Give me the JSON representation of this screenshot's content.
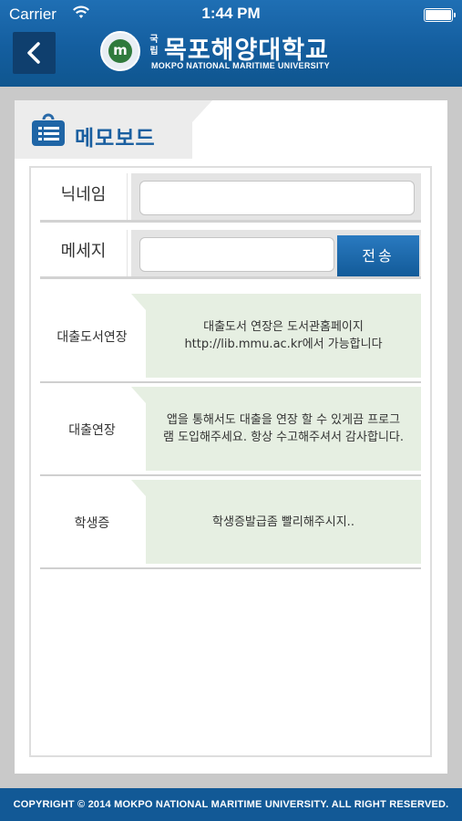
{
  "status_bar": {
    "carrier": "Carrier",
    "time": "1:44 PM"
  },
  "header": {
    "back_icon": "chevron-left-icon",
    "logo_badge": "국립",
    "logo_title": "목포해양대학교",
    "logo_subtitle": "MOKPO NATIONAL MARITIME UNIVERSITY",
    "emblem_letter": "m",
    "background_color": "#1667a8"
  },
  "page": {
    "title": "메모보드",
    "title_icon": "list-board-icon",
    "accent_color": "#1a5fa0"
  },
  "form": {
    "nickname_label": "닉네임",
    "nickname_value": "",
    "nickname_placeholder": "",
    "message_label": "메세지",
    "message_value": "",
    "message_placeholder": "",
    "send_label": "전송"
  },
  "memos": [
    {
      "name": "대출도서연장",
      "message": "대출도서 연장은 도서관홈페이지 http://lib.mmu.ac.kr에서 가능합니다"
    },
    {
      "name": "대출연장",
      "message": "앱을 통해서도 대출을 연장 할 수 있게끔 프로그램 도입해주세요. 항상 수고해주셔서 감사합니다."
    },
    {
      "name": "학생증",
      "message": "학생증발급좀 빨리해주시지.."
    }
  ],
  "footer": {
    "copyright": "COPYRIGHT © 2014 MOKPO NATIONAL MARITIME UNIVERSITY. ALL RIGHT RESERVED."
  }
}
